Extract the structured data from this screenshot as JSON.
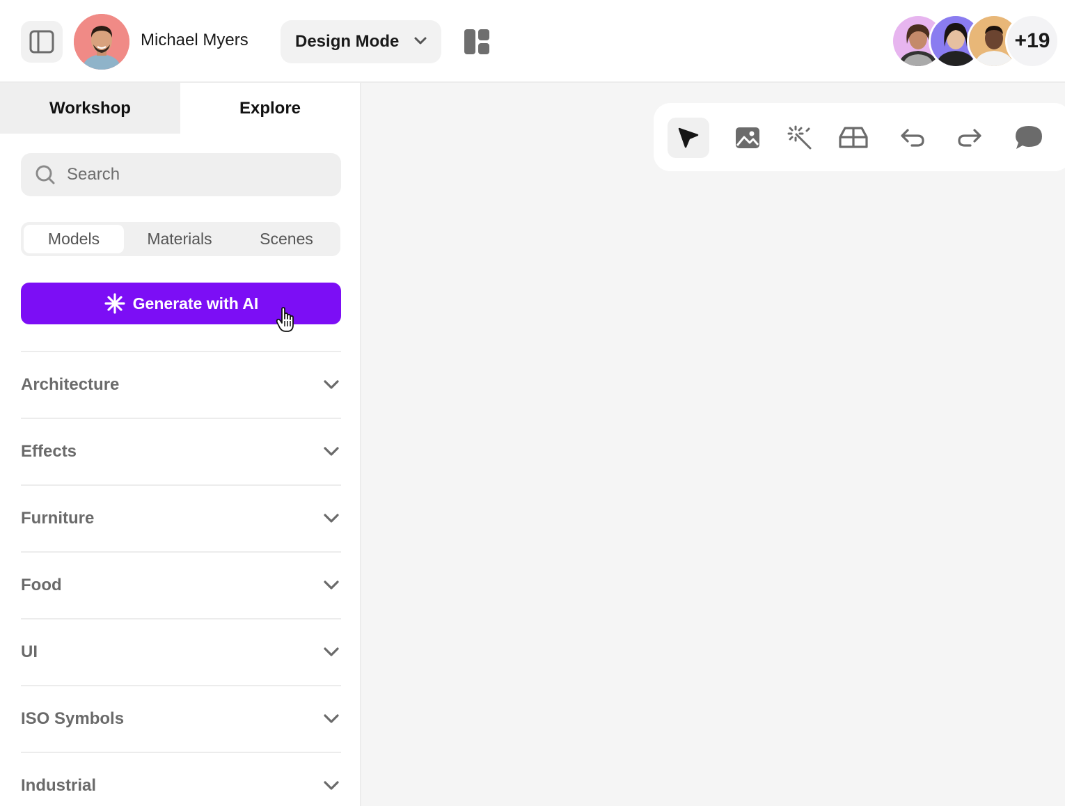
{
  "header": {
    "user_name": "Michael Myers",
    "mode_label": "Design Mode",
    "collaborators_more": "+19"
  },
  "sidebar": {
    "tabs": [
      {
        "label": "Workshop",
        "active": false
      },
      {
        "label": "Explore",
        "active": true
      }
    ],
    "search": {
      "placeholder": "Search",
      "value": ""
    },
    "segments": [
      {
        "label": "Models",
        "selected": true
      },
      {
        "label": "Materials",
        "selected": false
      },
      {
        "label": "Scenes",
        "selected": false
      }
    ],
    "generate_label": "Generate with AI",
    "categories": [
      {
        "label": "Architecture"
      },
      {
        "label": "Effects"
      },
      {
        "label": "Furniture"
      },
      {
        "label": "Food"
      },
      {
        "label": "UI"
      },
      {
        "label": "ISO Symbols"
      },
      {
        "label": "Industrial"
      }
    ]
  },
  "toolbar": {
    "tools": [
      "select-arrow-icon",
      "image-icon",
      "magic-wand-icon",
      "3d-box-icon",
      "undo-icon",
      "redo-icon",
      "comment-icon"
    ],
    "active_tool": "select-arrow-icon"
  },
  "colors": {
    "accent": "#7c0ef5",
    "canvas_bg": "#f5f5f5",
    "tab_inactive_bg": "#efefef",
    "category_text": "#6a6a6a"
  }
}
